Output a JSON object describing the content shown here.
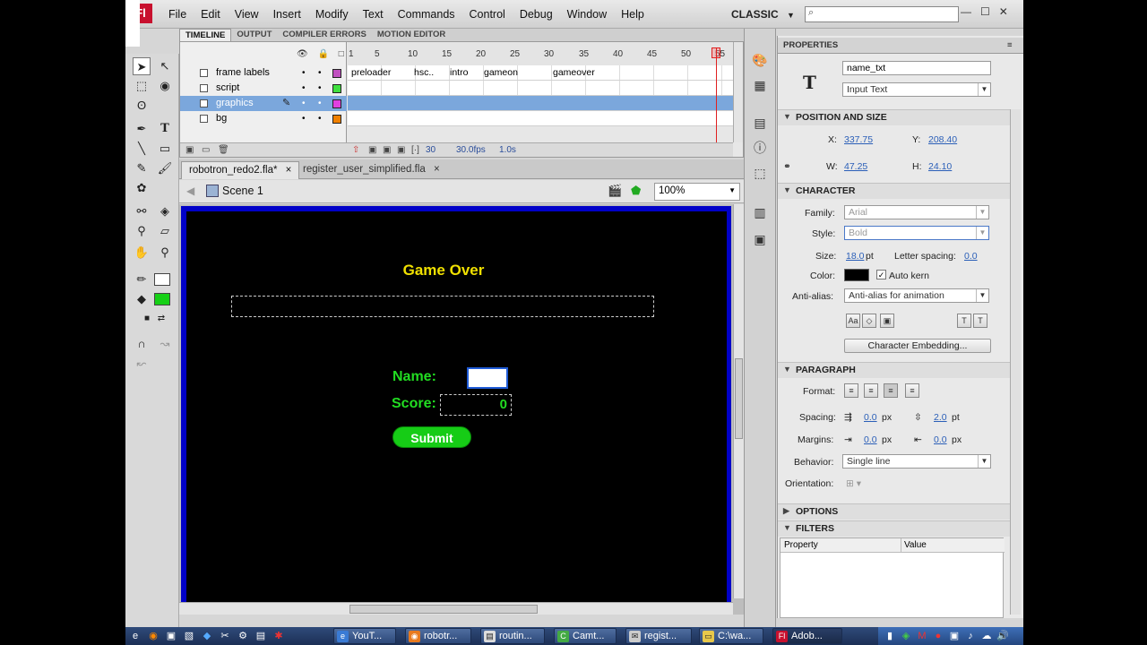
{
  "app": {
    "logo": "Fl",
    "menu": [
      "File",
      "Edit",
      "View",
      "Insert",
      "Modify",
      "Text",
      "Commands",
      "Control",
      "Debug",
      "Window",
      "Help"
    ],
    "workspace": "CLASSIC",
    "workspace_arrow": "▼",
    "window_buttons": [
      "—",
      "☐",
      "✕"
    ]
  },
  "timeline": {
    "tabs": [
      "TIMELINE",
      "OUTPUT",
      "COMPILER ERRORS",
      "MOTION EDITOR"
    ],
    "ruler": [
      "1",
      "5",
      "10",
      "15",
      "20",
      "25",
      "30",
      "35",
      "40",
      "45",
      "50",
      "55"
    ],
    "layers": [
      {
        "name": "frame labels",
        "color": "#c050c0"
      },
      {
        "name": "script",
        "color": "#40e040"
      },
      {
        "name": "graphics",
        "color": "#e040e0"
      },
      {
        "name": "bg",
        "color": "#f08000"
      }
    ],
    "frame_labels": [
      "preloader",
      "hsc..",
      "intro",
      "gameon",
      "gameover"
    ],
    "footer": {
      "frame": "30",
      "fps": "30.0fps",
      "time": "1.0s"
    }
  },
  "doc_tabs": [
    {
      "label": "robotron_redo2.fla*",
      "close": "×"
    },
    {
      "label": "register_user_simplified.fla",
      "close": "×"
    }
  ],
  "scene": {
    "label": "Scene 1",
    "zoom": "100%",
    "zoom_arrow": "▼"
  },
  "stage": {
    "title": "Game Over",
    "name_label": "Name:",
    "score_label": "Score:",
    "score_value": "0",
    "submit_label": "Submit",
    "bg_color": "#000000",
    "border_color": "#0000c8"
  },
  "properties": {
    "tab_label": "PROPERTIES",
    "instance_name": "name_txt",
    "text_type": "Input Text",
    "position_size": {
      "header": "POSITION AND SIZE",
      "x_label": "X:",
      "x": "337.75",
      "y_label": "Y:",
      "y": "208.40",
      "w_label": "W:",
      "w": "47.25",
      "h_label": "H:",
      "h": "24.10"
    },
    "character": {
      "header": "CHARACTER",
      "family_label": "Family:",
      "family": "Arial",
      "style_label": "Style:",
      "style": "Bold",
      "size_label": "Size:",
      "size": "18.0",
      "size_unit": "pt",
      "letter_spacing_label": "Letter spacing:",
      "letter_spacing": "0.0",
      "color_label": "Color:",
      "auto_kern_label": "Auto kern",
      "antialias_label": "Anti-alias:",
      "antialias": "Anti-alias for animation",
      "embed_button": "Character Embedding..."
    },
    "paragraph": {
      "header": "PARAGRAPH",
      "format_label": "Format:",
      "spacing_label": "Spacing:",
      "spacing_indent": "0.0",
      "spacing_line": "2.0",
      "margins_label": "Margins:",
      "margin_left": "0.0",
      "margin_right": "0.0",
      "px": "px",
      "pt": "pt",
      "behavior_label": "Behavior:",
      "behavior": "Single line",
      "orientation_label": "Orientation:"
    },
    "options_header": "OPTIONS",
    "filters_header": "FILTERS",
    "filters_columns": [
      "Property",
      "Value"
    ]
  },
  "taskbar": {
    "buttons": [
      "YouT...",
      "robotr...",
      "routin...",
      "Camt...",
      "regist...",
      "C:\\wa...",
      "Adob..."
    ]
  }
}
